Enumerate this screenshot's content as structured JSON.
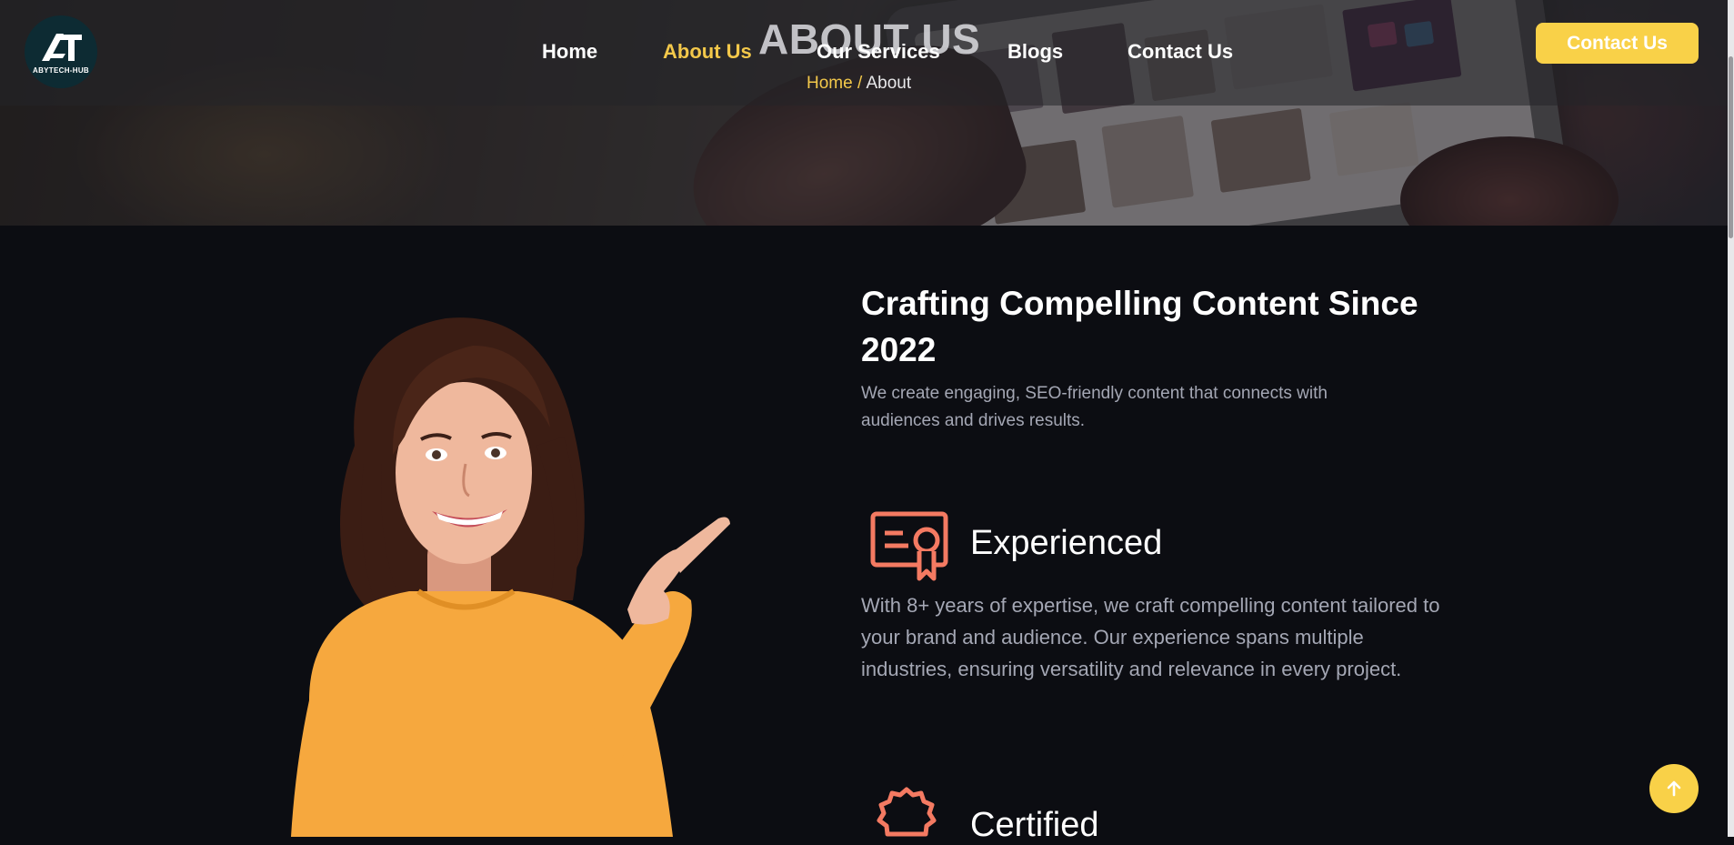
{
  "header": {
    "logo_text": "ABYTECH-HUB",
    "nav": [
      {
        "label": "Home",
        "active": false
      },
      {
        "label": "About Us",
        "active": true
      },
      {
        "label": "Our Services",
        "active": false
      },
      {
        "label": "Blogs",
        "active": false
      },
      {
        "label": "Contact Us",
        "active": false
      }
    ],
    "cta_label": "Contact Us"
  },
  "hero": {
    "title": "ABOUT US",
    "breadcrumb": {
      "home": "Home",
      "separator": "/",
      "current": "About"
    }
  },
  "about": {
    "heading": "Crafting Compelling Content Since 2022",
    "subtext": "We create engaging, SEO-friendly content that connects with audiences and drives results.",
    "features": [
      {
        "icon": "certificate-icon",
        "title": "Experienced",
        "description": "With 8+ years of expertise, we craft compelling content tailored to your brand and audience. Our experience spans multiple industries, ensuring versatility and relevance in every project."
      },
      {
        "icon": "badge-icon",
        "title": "Certified",
        "description": ""
      }
    ]
  },
  "scroll_top": {
    "icon": "arrow-up-icon"
  },
  "colors": {
    "accent": "#f9d148",
    "active_nav": "#f3c84a",
    "icon": "#f47a62",
    "page_bg": "#0c0d12",
    "muted_text": "#a4a7b4"
  }
}
